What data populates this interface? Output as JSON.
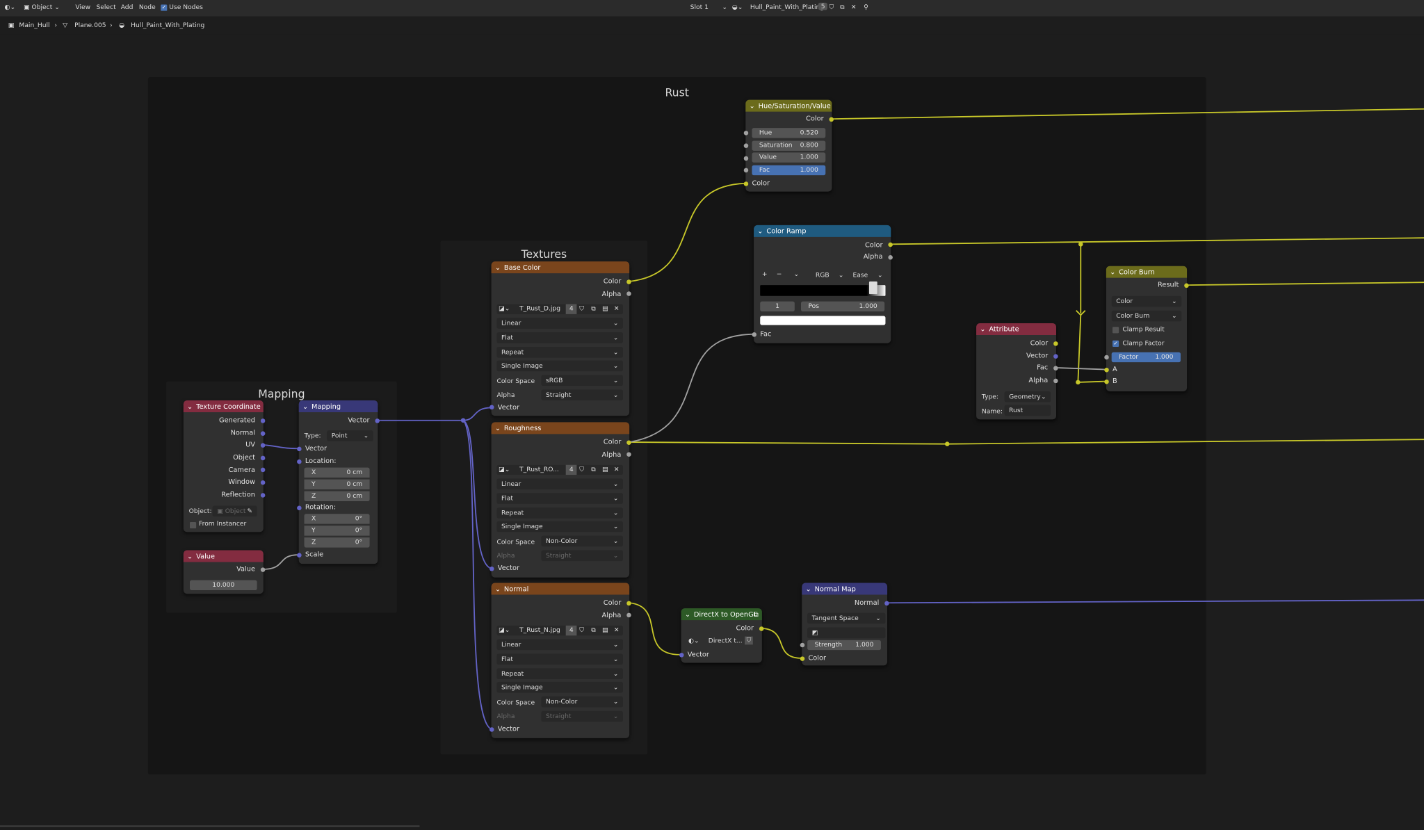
{
  "topbar": {
    "editor_icon": "node-editor-icon",
    "mode": "Object",
    "menu": [
      "View",
      "Select",
      "Add",
      "Node"
    ],
    "use_nodes": "Use Nodes",
    "slot": "Slot 1",
    "material_name": "Hull_Paint_With_Plating",
    "users": "5"
  },
  "breadcrumb": [
    "Main_Hull",
    "Plane.005",
    "Hull_Paint_With_Plating"
  ],
  "frames": {
    "rust": "Rust",
    "textures": "Textures",
    "mapping": "Mapping"
  },
  "hsv": {
    "title": "Hue/Saturation/Value",
    "out": "Color",
    "hue_l": "Hue",
    "hue": "0.520",
    "sat_l": "Saturation",
    "sat": "0.800",
    "val_l": "Value",
    "val": "1.000",
    "fac_l": "Fac",
    "fac": "1.000",
    "in": "Color"
  },
  "ramp": {
    "title": "Color Ramp",
    "out1": "Color",
    "out2": "Alpha",
    "mode": "RGB",
    "interp": "Ease",
    "stop_index": "1",
    "pos_l": "Pos",
    "pos": "1.000",
    "in": "Fac",
    "add": "+",
    "remove": "−"
  },
  "burn": {
    "title": "Color Burn",
    "out": "Result",
    "dtype": "Color",
    "blend": "Color Burn",
    "clamp_result": "Clamp Result",
    "clamp_factor": "Clamp Factor",
    "factor_l": "Factor",
    "factor": "1.000",
    "a": "A",
    "b": "B"
  },
  "attr": {
    "title": "Attribute",
    "outs": [
      "Color",
      "Vector",
      "Fac",
      "Alpha"
    ],
    "type_l": "Type:",
    "type": "Geometry",
    "name_l": "Name:",
    "name": "Rust"
  },
  "tex_base": {
    "title": "Base Color",
    "out1": "Color",
    "out2": "Alpha",
    "image": "T_Rust_D.jpg",
    "users": "4",
    "interp": "Linear",
    "proj": "Flat",
    "ext": "Repeat",
    "src": "Single Image",
    "cs_l": "Color Space",
    "cs": "sRGB",
    "alpha_l": "Alpha",
    "alpha": "Straight",
    "in": "Vector"
  },
  "tex_rough": {
    "title": "Roughness",
    "out1": "Color",
    "out2": "Alpha",
    "image": "T_Rust_RO...",
    "users": "4",
    "interp": "Linear",
    "proj": "Flat",
    "ext": "Repeat",
    "src": "Single Image",
    "cs_l": "Color Space",
    "cs": "Non-Color",
    "alpha_l": "Alpha",
    "alpha": "Straight",
    "in": "Vector"
  },
  "tex_norm": {
    "title": "Normal",
    "out1": "Color",
    "out2": "Alpha",
    "image": "T_Rust_N.jpg",
    "users": "4",
    "interp": "Linear",
    "proj": "Flat",
    "ext": "Repeat",
    "src": "Single Image",
    "cs_l": "Color Space",
    "cs": "Non-Color",
    "alpha_l": "Alpha",
    "alpha": "Straight",
    "in": "Vector"
  },
  "dx": {
    "title": "DirectX to OpenGL",
    "out": "Color",
    "group": "DirectX t...",
    "in": "Vector"
  },
  "nmap": {
    "title": "Normal Map",
    "out": "Normal",
    "space": "Tangent Space",
    "strength_l": "Strength",
    "strength": "1.000",
    "in": "Color"
  },
  "texcoord": {
    "title": "Texture Coordinate",
    "outs": [
      "Generated",
      "Normal",
      "UV",
      "Object",
      "Camera",
      "Window",
      "Reflection"
    ],
    "object_l": "Object:",
    "object_ph": "Object",
    "instancer": "From Instancer"
  },
  "mapping": {
    "title": "Mapping",
    "out": "Vector",
    "type_l": "Type:",
    "type": "Point",
    "in": "Vector",
    "loc_l": "Location:",
    "loc": [
      [
        "X",
        "0 cm"
      ],
      [
        "Y",
        "0 cm"
      ],
      [
        "Z",
        "0 cm"
      ]
    ],
    "rot_l": "Rotation:",
    "rot": [
      [
        "X",
        "0°"
      ],
      [
        "Y",
        "0°"
      ],
      [
        "Z",
        "0°"
      ]
    ],
    "scale": "Scale"
  },
  "value": {
    "title": "Value",
    "out": "Value",
    "val": "10.000"
  },
  "colors": {
    "yellow": "#c7c729",
    "purple": "#6363c7",
    "grey": "#a1a1a1",
    "texture_header": "#7a451c",
    "color_header": "#6b6b1b",
    "input_header": "#832c40",
    "vector_header": "#383878",
    "converter_header": "#1f5b80",
    "group_header": "#2d5a26",
    "selected_field": "#4772b3"
  }
}
